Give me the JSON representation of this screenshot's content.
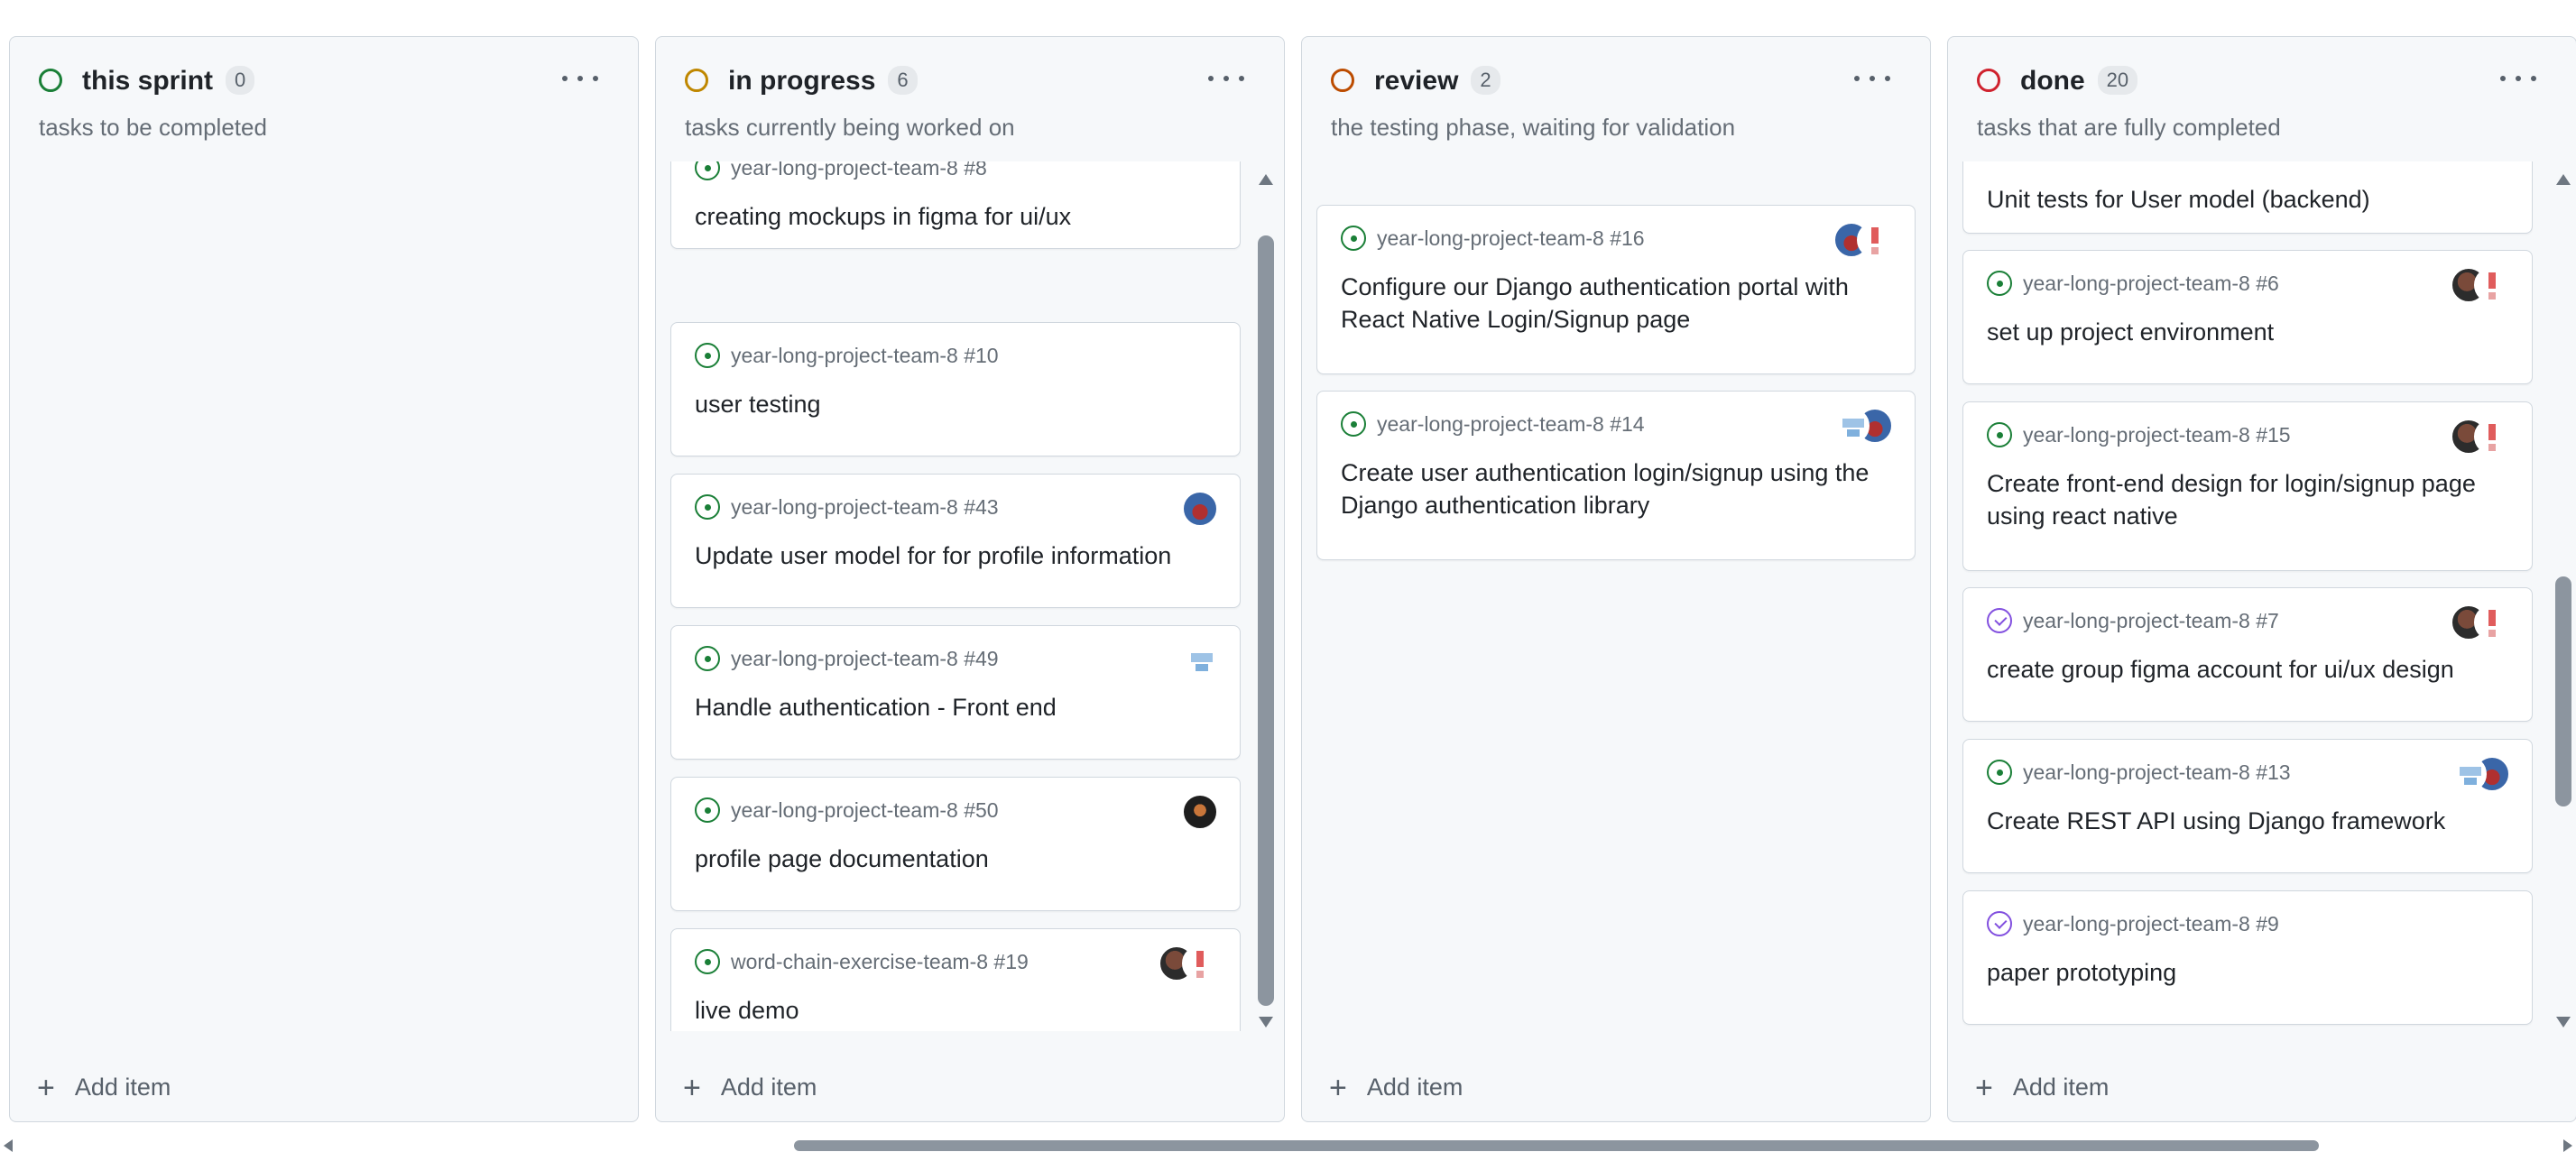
{
  "colors": {
    "open_issue": "#1a7f37",
    "closed_issue": "#8250df",
    "this_sprint": "#1a7f37",
    "in_progress": "#bf8700",
    "review": "#bc4c00",
    "done": "#cf222e"
  },
  "add_item_label": "Add item",
  "columns": [
    {
      "title": "this sprint",
      "count": "0",
      "description": "tasks to be completed",
      "cards": []
    },
    {
      "title": "in progress",
      "count": "6",
      "description": "tasks currently being worked on",
      "cards": [
        {
          "meta": "year-long-project-team-8 #8",
          "title": "creating mockups in figma for ui/ux",
          "state": "open",
          "avatars": []
        },
        {
          "meta": "year-long-project-team-8 #10",
          "title": "user testing",
          "state": "open",
          "avatars": []
        },
        {
          "meta": "year-long-project-team-8 #43",
          "title": "Update user model for for profile information",
          "state": "open",
          "avatars": [
            "avatar-red-blue"
          ]
        },
        {
          "meta": "year-long-project-team-8 #49",
          "title": "Handle authentication - Front end",
          "state": "open",
          "avatars": [
            "avatar-blue-pixel"
          ]
        },
        {
          "meta": "year-long-project-team-8 #50",
          "title": "profile page documentation",
          "state": "open",
          "avatars": [
            "avatar-dark"
          ]
        },
        {
          "meta": "word-chain-exercise-team-8 #19",
          "title": "live demo",
          "state": "open",
          "avatars": [
            "avatar-photo",
            "avatar-red-pixel"
          ]
        }
      ]
    },
    {
      "title": "review",
      "count": "2",
      "description": "the testing phase, waiting for validation",
      "cards": [
        {
          "meta": "year-long-project-team-8 #16",
          "title": "Configure our Django authentication portal with React Native Login/Signup page",
          "state": "open",
          "avatars": [
            "avatar-red-blue",
            "avatar-red-pixel"
          ]
        },
        {
          "meta": "year-long-project-team-8 #14",
          "title": "Create user authentication login/signup using the Django authentication library",
          "state": "open",
          "avatars": [
            "avatar-blue-pixel",
            "avatar-red-blue"
          ]
        }
      ]
    },
    {
      "title": "done",
      "count": "20",
      "description": "tasks that are fully completed",
      "cards": [
        {
          "meta": "",
          "title": "Unit tests for User model (backend)",
          "state": "open",
          "avatars": []
        },
        {
          "meta": "year-long-project-team-8 #6",
          "title": "set up project environment",
          "state": "open",
          "avatars": [
            "avatar-photo",
            "avatar-red-pixel"
          ]
        },
        {
          "meta": "year-long-project-team-8 #15",
          "title": "Create front-end design for login/signup page using react native",
          "state": "open",
          "avatars": [
            "avatar-photo",
            "avatar-red-pixel"
          ]
        },
        {
          "meta": "year-long-project-team-8 #7",
          "title": "create group figma account for ui/ux design",
          "state": "closed",
          "avatars": [
            "avatar-photo",
            "avatar-red-pixel"
          ]
        },
        {
          "meta": "year-long-project-team-8 #13",
          "title": "Create REST API using Django framework",
          "state": "open",
          "avatars": [
            "avatar-blue-pixel",
            "avatar-red-blue"
          ]
        },
        {
          "meta": "year-long-project-team-8 #9",
          "title": "paper prototyping",
          "state": "closed",
          "avatars": []
        }
      ]
    }
  ]
}
